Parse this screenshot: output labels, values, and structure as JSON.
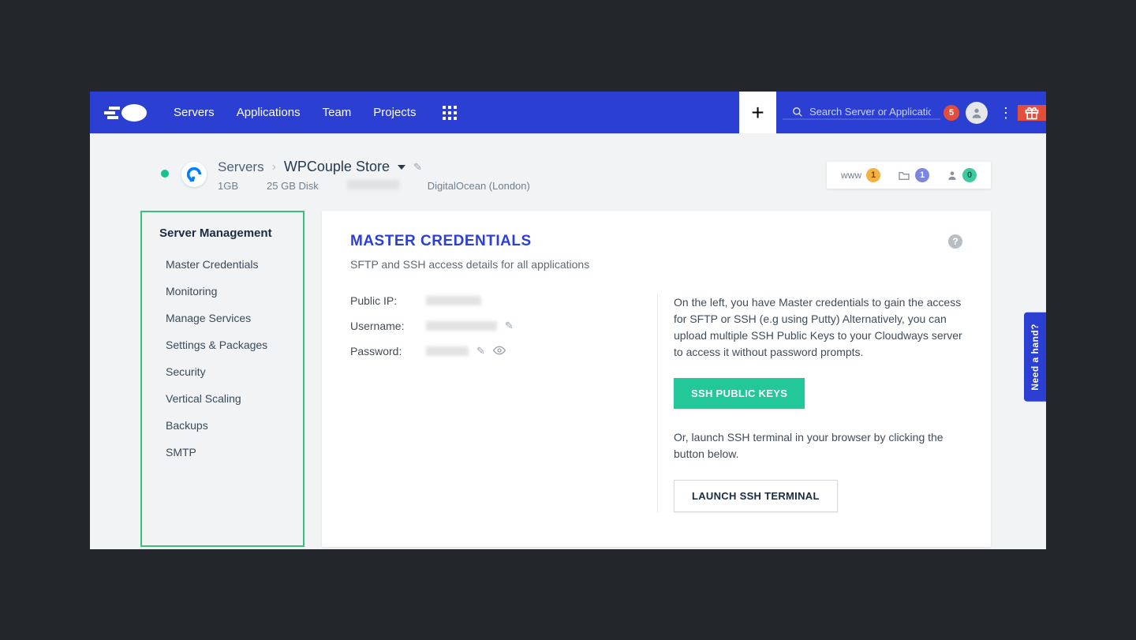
{
  "nav": {
    "items": [
      "Servers",
      "Applications",
      "Team",
      "Projects"
    ],
    "search_placeholder": "Search Server or Application",
    "notification_count": "5"
  },
  "breadcrumb": {
    "root": "Servers",
    "current": "WPCouple Store",
    "ram": "1GB",
    "disk": "25 GB Disk",
    "provider_location": "DigitalOcean (London)"
  },
  "counters": {
    "www_label": "www",
    "www": "1",
    "app": "1",
    "user": "0"
  },
  "sidebar": {
    "title": "Server Management",
    "items": [
      "Master Credentials",
      "Monitoring",
      "Manage Services",
      "Settings & Packages",
      "Security",
      "Vertical Scaling",
      "Backups",
      "SMTP"
    ]
  },
  "panel": {
    "title": "MASTER CREDENTIALS",
    "subtitle": "SFTP and SSH access details for all applications",
    "labels": {
      "ip": "Public IP:",
      "user": "Username:",
      "pass": "Password:"
    },
    "right": {
      "paragraph1": "On the left, you have Master credentials to gain the access for SFTP or SSH (e.g using Putty) Alternatively, you can upload multiple SSH Public Keys to your Cloudways server to access it without password prompts.",
      "btn_keys": "SSH PUBLIC KEYS",
      "paragraph2": "Or, launch SSH terminal in your browser by clicking the button below.",
      "btn_terminal": "LAUNCH SSH TERMINAL"
    }
  },
  "help_tab": "Need a hand?"
}
